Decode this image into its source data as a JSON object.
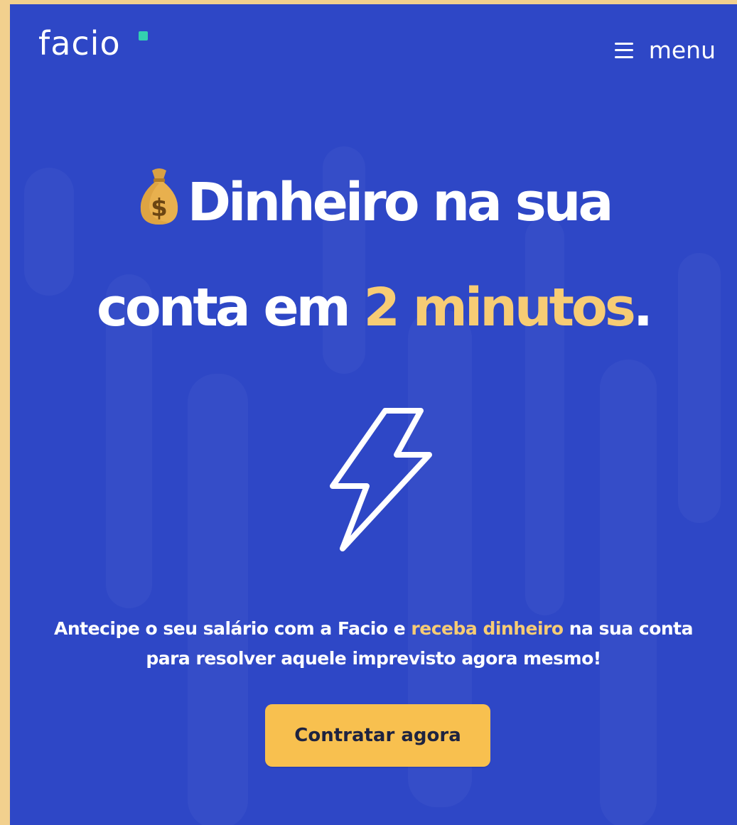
{
  "header": {
    "logo_text": "facio",
    "menu_label": "menu"
  },
  "hero": {
    "line1": "Dinheiro na sua",
    "line2_prefix": "conta em ",
    "line2_accent": "2 minutos",
    "line2_suffix": "."
  },
  "subtitle": {
    "part1": "Antecipe o seu salário com a Facio e ",
    "accent": "receba dinheiro",
    "part2": " na sua conta",
    "line2": "para resolver aquele imprevisto agora mesmo!"
  },
  "cta": {
    "label": "Contratar agora"
  },
  "icons": {
    "logo_mark": "square-dot-icon",
    "menu": "hamburger-icon",
    "emoji": "money-bag-icon",
    "hero": "lightning-bolt-icon"
  },
  "colors": {
    "background": "#2E47C6",
    "accent": "#F7CC74",
    "button": "#F8C04F",
    "logo_dot": "#33D1B0",
    "page_border": "#F2D08E"
  }
}
